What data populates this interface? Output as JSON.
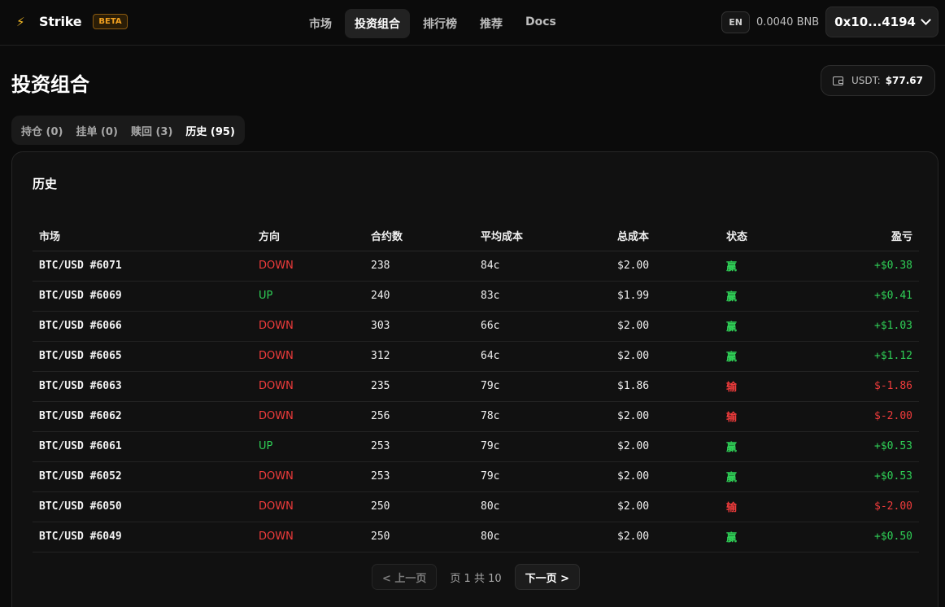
{
  "header": {
    "brand": "Strike",
    "badge": "BETA",
    "nav": [
      "市场",
      "投资组合",
      "排行榜",
      "推荐",
      "Docs"
    ],
    "active_nav": 1,
    "lang": "EN",
    "balance": "0.0040 BNB",
    "wallet": "0x10...4194"
  },
  "page": {
    "title": "投资组合",
    "usdt_label": "USDT:",
    "usdt_value": "$77.67"
  },
  "tabs": [
    "持仓 (0)",
    "挂单 (0)",
    "赎回 (3)",
    "历史 (95)"
  ],
  "active_tab": 3,
  "card": {
    "title": "历史",
    "columns": [
      "市场",
      "方向",
      "合约数",
      "平均成本",
      "总成本",
      "状态",
      "盈亏"
    ],
    "rows": [
      {
        "market": "BTC/USD #6071",
        "direction": "DOWN",
        "qty": "238",
        "avg": "84c",
        "total": "$2.00",
        "status": "赢",
        "pnl": "+$0.38"
      },
      {
        "market": "BTC/USD #6069",
        "direction": "UP",
        "qty": "240",
        "avg": "83c",
        "total": "$1.99",
        "status": "赢",
        "pnl": "+$0.41"
      },
      {
        "market": "BTC/USD #6066",
        "direction": "DOWN",
        "qty": "303",
        "avg": "66c",
        "total": "$2.00",
        "status": "赢",
        "pnl": "+$1.03"
      },
      {
        "market": "BTC/USD #6065",
        "direction": "DOWN",
        "qty": "312",
        "avg": "64c",
        "total": "$2.00",
        "status": "赢",
        "pnl": "+$1.12"
      },
      {
        "market": "BTC/USD #6063",
        "direction": "DOWN",
        "qty": "235",
        "avg": "79c",
        "total": "$1.86",
        "status": "输",
        "pnl": "$-1.86"
      },
      {
        "market": "BTC/USD #6062",
        "direction": "DOWN",
        "qty": "256",
        "avg": "78c",
        "total": "$2.00",
        "status": "输",
        "pnl": "$-2.00"
      },
      {
        "market": "BTC/USD #6061",
        "direction": "UP",
        "qty": "253",
        "avg": "79c",
        "total": "$2.00",
        "status": "赢",
        "pnl": "+$0.53"
      },
      {
        "market": "BTC/USD #6052",
        "direction": "DOWN",
        "qty": "253",
        "avg": "79c",
        "total": "$2.00",
        "status": "赢",
        "pnl": "+$0.53"
      },
      {
        "market": "BTC/USD #6050",
        "direction": "DOWN",
        "qty": "250",
        "avg": "80c",
        "total": "$2.00",
        "status": "输",
        "pnl": "$-2.00"
      },
      {
        "market": "BTC/USD #6049",
        "direction": "DOWN",
        "qty": "250",
        "avg": "80c",
        "total": "$2.00",
        "status": "赢",
        "pnl": "+$0.50"
      }
    ]
  },
  "pagination": {
    "prev": "< 上一页",
    "info": "页 1 共 10",
    "next": "下一页 >"
  },
  "colors": {
    "accent": "#f0a020",
    "win": "#2fcf56",
    "lose": "#ef3b3b"
  },
  "icons": [
    "bolt-icon",
    "chevron-down-icon",
    "wallet-icon"
  ]
}
